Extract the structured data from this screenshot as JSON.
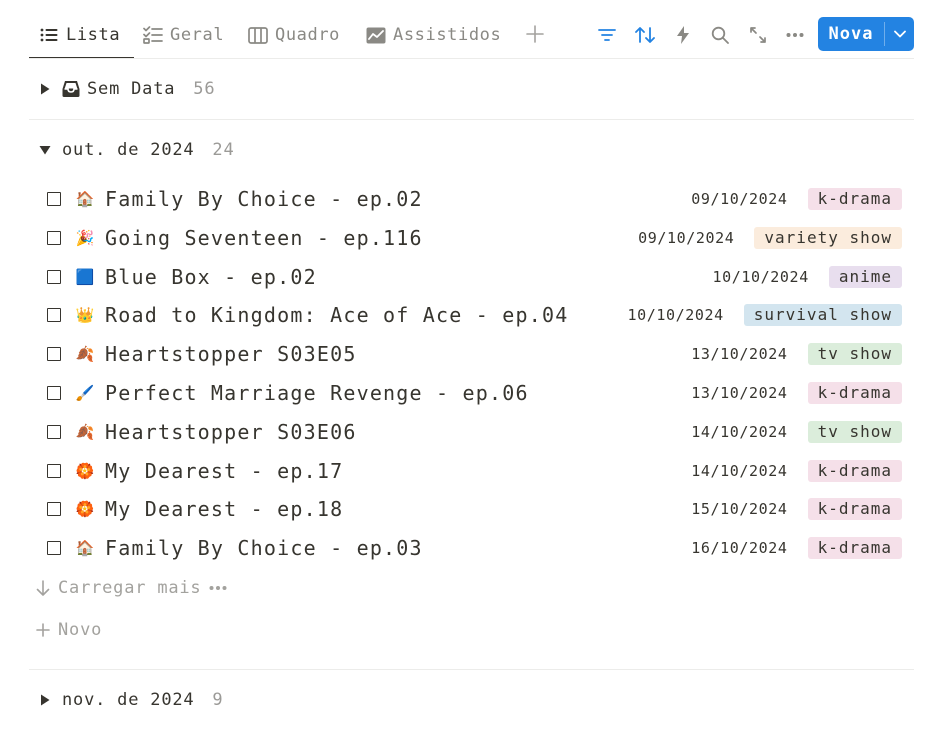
{
  "tabs": [
    {
      "label": "Lista",
      "icon": "list-icon",
      "active": true
    },
    {
      "label": "Geral",
      "icon": "checklist-icon",
      "active": false
    },
    {
      "label": "Quadro",
      "icon": "board-icon",
      "active": false
    },
    {
      "label": "Assistidos",
      "icon": "chart-icon",
      "active": false
    }
  ],
  "toolbar": {
    "new_label": "Nova",
    "accent_color": "#2383e2",
    "icons": [
      "filter-icon",
      "sort-icon",
      "lightning-icon",
      "search-icon",
      "expand-icon",
      "more-icon"
    ]
  },
  "groups": {
    "no_date": {
      "label": "Sem Data",
      "count": "56",
      "icon": "inbox-icon"
    },
    "oct": {
      "label": "out. de 2024",
      "count": "24"
    },
    "nov": {
      "label": "nov. de 2024",
      "count": "9"
    }
  },
  "items": [
    {
      "emoji": "🏠",
      "title": "Family By Choice - ep.02",
      "date": "09/10/2024",
      "tag": "k-drama"
    },
    {
      "emoji": "🎉",
      "title": "Going Seventeen - ep.116",
      "date": "09/10/2024",
      "tag": "variety show"
    },
    {
      "emoji": "🟦",
      "title": "Blue Box - ep.02",
      "date": "10/10/2024",
      "tag": "anime"
    },
    {
      "emoji": "👑",
      "title": "Road to Kingdom: Ace of Ace - ep.04",
      "date": "10/10/2024",
      "tag": "survival show"
    },
    {
      "emoji": "🍂",
      "title": "Heartstopper S03E05",
      "date": "13/10/2024",
      "tag": "tv show"
    },
    {
      "emoji": "🖌️",
      "title": "Perfect Marriage Revenge - ep.06",
      "date": "13/10/2024",
      "tag": "k-drama"
    },
    {
      "emoji": "🍂",
      "title": "Heartstopper S03E06",
      "date": "14/10/2024",
      "tag": "tv show"
    },
    {
      "emoji": "🏵️",
      "title": "My Dearest - ep.17",
      "date": "14/10/2024",
      "tag": "k-drama"
    },
    {
      "emoji": "🏵️",
      "title": "My Dearest - ep.18",
      "date": "15/10/2024",
      "tag": "k-drama"
    },
    {
      "emoji": "🏠",
      "title": "Family By Choice - ep.03",
      "date": "16/10/2024",
      "tag": "k-drama"
    }
  ],
  "tag_colors": {
    "k-drama": "#f5e0e9",
    "variety show": "#fbecdd",
    "anime": "#e8deee",
    "survival show": "#d3e5ef",
    "tv show": "#dbeddb"
  },
  "load_more_label": "Carregar mais",
  "new_item_label": "Novo"
}
